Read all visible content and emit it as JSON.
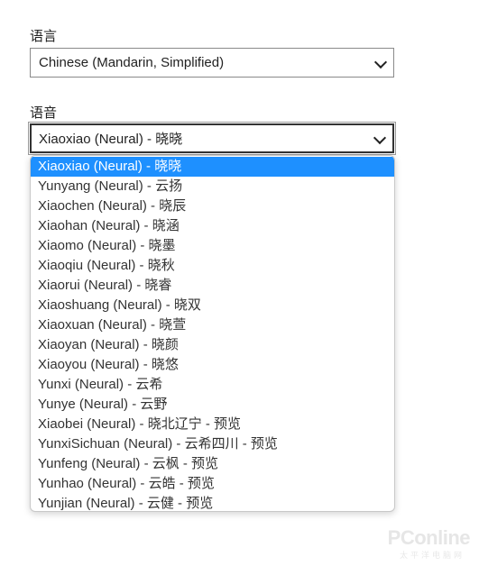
{
  "language": {
    "label": "语言",
    "selected": "Chinese (Mandarin, Simplified)"
  },
  "voice": {
    "label": "语音",
    "selected": "Xiaoxiao (Neural) - 晓晓",
    "options": [
      "Xiaoxiao (Neural) - 晓晓",
      "Yunyang (Neural) - 云扬",
      "Xiaochen (Neural) - 晓辰",
      "Xiaohan (Neural) - 晓涵",
      "Xiaomo (Neural) - 晓墨",
      "Xiaoqiu (Neural) - 晓秋",
      "Xiaorui (Neural) - 晓睿",
      "Xiaoshuang (Neural) - 晓双",
      "Xiaoxuan (Neural) - 晓萱",
      "Xiaoyan (Neural) - 晓颜",
      "Xiaoyou (Neural) - 晓悠",
      "Yunxi (Neural) - 云希",
      "Yunye (Neural) - 云野",
      "Xiaobei (Neural) - 晓北辽宁 - 预览",
      "YunxiSichuan (Neural) - 云希四川 - 预览",
      "Yunfeng (Neural) - 云枫 - 预览",
      "Yunhao (Neural) - 云皓 - 预览",
      "Yunjian (Neural) - 云健 - 预览"
    ]
  },
  "watermark": {
    "brand": "PConline",
    "sub": "太平洋电脑网"
  },
  "colors": {
    "selected_option": "#1e90ff"
  }
}
